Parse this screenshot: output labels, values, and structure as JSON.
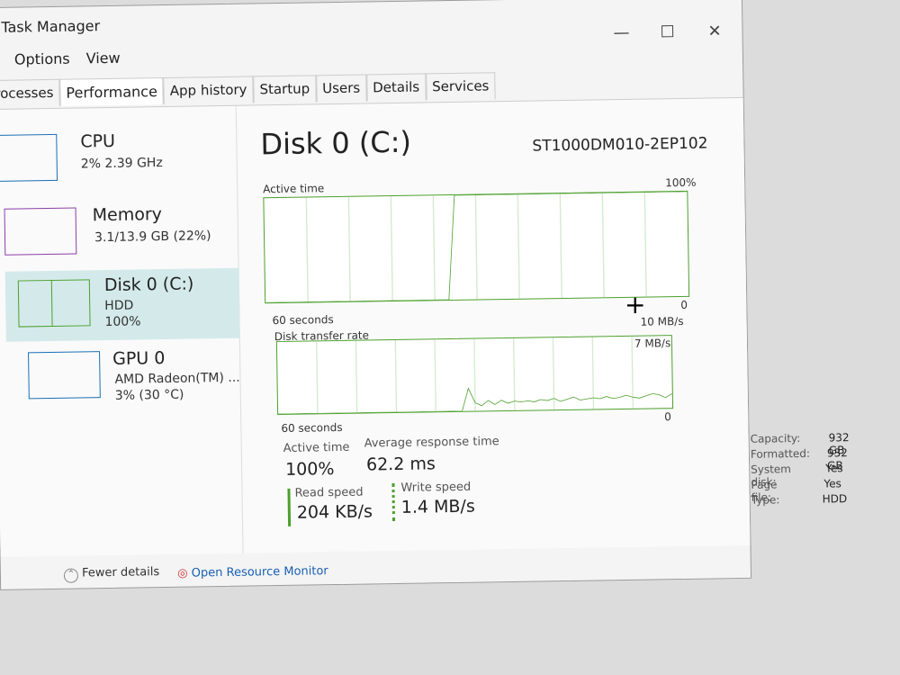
{
  "window": {
    "title": "Task Manager",
    "controls": [
      "—",
      "☐",
      "✕"
    ]
  },
  "menu": [
    "Options",
    "View"
  ],
  "tabs": [
    {
      "label": "Processes",
      "active": false
    },
    {
      "label": "Performance",
      "active": true
    },
    {
      "label": "App history",
      "active": false
    },
    {
      "label": "Startup",
      "active": false
    },
    {
      "label": "Users",
      "active": false
    },
    {
      "label": "Details",
      "active": false
    },
    {
      "label": "Services",
      "active": false
    }
  ],
  "sidebar": [
    {
      "name": "CPU",
      "line1": "2% 2.39 GHz",
      "line2": "",
      "color": "#1a6fb5"
    },
    {
      "name": "Memory",
      "line1": "3.1/13.9 GB (22%)",
      "line2": "",
      "color": "#8b3fa8"
    },
    {
      "name": "Disk 0 (C:)",
      "line1": "HDD",
      "line2": "100%",
      "color": "#4ca02c",
      "selected": true
    },
    {
      "name": "GPU 0",
      "line1": "AMD Radeon(TM) ...",
      "line2": "3% (30 °C)",
      "color": "#1a6fb5"
    }
  ],
  "main": {
    "title": "Disk 0 (C:)",
    "model": "ST1000DM010-2EP102",
    "active_graph": {
      "label": "Active time",
      "max": "100%",
      "min": "0",
      "span": "60 seconds",
      "values": [
        0,
        0,
        0,
        0,
        0,
        0,
        0,
        0,
        0,
        0,
        0,
        0,
        0,
        0,
        0,
        0,
        0,
        0,
        0,
        0,
        0,
        0,
        0,
        0,
        0,
        0,
        0,
        100,
        100,
        100,
        100,
        100,
        100,
        100,
        100,
        100,
        100,
        100,
        100,
        100,
        100,
        100,
        100,
        100,
        100,
        100,
        100,
        100,
        100,
        100,
        100,
        100,
        100,
        100,
        100,
        100,
        100,
        100,
        100,
        100,
        100
      ]
    },
    "transfer_graph": {
      "label": "Disk transfer rate",
      "max": "10 MB/s",
      "secondary": "7 MB/s",
      "min": "0",
      "span": "60 seconds",
      "values": [
        0,
        0,
        0,
        0,
        0,
        0,
        0,
        0,
        0,
        0,
        0,
        0,
        0,
        0,
        0,
        0,
        0,
        0,
        0,
        0,
        0,
        0,
        0,
        0,
        0,
        0,
        0,
        0,
        0,
        2.2,
        0.8,
        0.5,
        1,
        0.6,
        1,
        0.7,
        0.9,
        0.8,
        0.9,
        0.8,
        1,
        0.9,
        1.1,
        0.8,
        1,
        1.2,
        0.9,
        1,
        1.1,
        1,
        1.2,
        1,
        1.1,
        1.3,
        1.1,
        1,
        1.2,
        1.4,
        1.3,
        1,
        1.4
      ]
    },
    "stats": {
      "active_time_label": "Active time",
      "active_time": "100%",
      "avg_resp_label": "Average response time",
      "avg_resp": "62.2 ms",
      "read_label": "Read speed",
      "read": "204 KB/s",
      "write_label": "Write speed",
      "write": "1.4 MB/s"
    },
    "props": [
      {
        "k": "Capacity:",
        "v": "932 GB"
      },
      {
        "k": "Formatted:",
        "v": "932 GB"
      },
      {
        "k": "System disk:",
        "v": "Yes"
      },
      {
        "k": "Page file:",
        "v": "Yes"
      },
      {
        "k": "Type:",
        "v": "HDD"
      }
    ]
  },
  "footer": {
    "fewer": "Fewer details",
    "resmon": "Open Resource Monitor"
  }
}
